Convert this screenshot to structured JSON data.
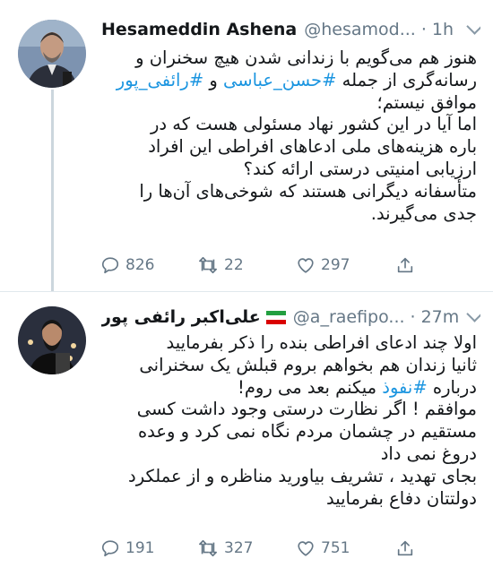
{
  "tweets": [
    {
      "name": "Hesameddin Ashena",
      "handle": "@hesamod...",
      "separator": "·",
      "time": "1h",
      "lines": [
        [
          {
            "t": "هنوز هم می‌گویم با زندانی شدن هیچ سخنران و",
            "tag": false
          }
        ],
        [
          {
            "t": "رسانه‌گری از جمله  ",
            "tag": false
          },
          {
            "t": "#حسن_عباسی",
            "tag": true
          },
          {
            "t": " و ",
            "tag": false
          },
          {
            "t": "#رائفی_پور",
            "tag": true
          }
        ],
        [
          {
            "t": "موافق نیستم؛",
            "tag": false
          }
        ],
        [
          {
            "t": "اما آیا در این کشور نهاد مسئولی هست که در",
            "tag": false
          }
        ],
        [
          {
            "t": "باره هزینه‌های ملی ادعاهای افراطی این افراد",
            "tag": false
          }
        ],
        [
          {
            "t": "ارزیابی امنیتی درستی ارائه کند؟",
            "tag": false
          }
        ],
        [
          {
            "t": "متأسفانه دیگرانی هستند که شوخی‌های آن‌ها را",
            "tag": false
          }
        ],
        [
          {
            "t": "جدی می‌گیرند.",
            "tag": false
          }
        ]
      ],
      "replies": "826",
      "retweets": "22",
      "likes": "297"
    },
    {
      "name": "علی‌اکبر رائفی پور",
      "handle": "@a_raefipo...",
      "separator": "·",
      "time": "27m",
      "lines": [
        [
          {
            "t": "اولا چند ادعای افراطی بنده را ذکر بفرمایید",
            "tag": false
          }
        ],
        [
          {
            "t": "ثانیا زندان هم بخواهم بروم قبلش یک سخنرانی",
            "tag": false
          }
        ],
        [
          {
            "t": "درباره ",
            "tag": false
          },
          {
            "t": "#نفوذ",
            "tag": true
          },
          {
            "t": " میکنم بعد می روم!",
            "tag": false
          }
        ],
        [
          {
            "t": "موافقم ! اگر نظارت درستی وجود داشت کسی",
            "tag": false
          }
        ],
        [
          {
            "t": "مستقیم در چشمان مردم نگاه نمی کرد و وعده",
            "tag": false
          }
        ],
        [
          {
            "t": "دروغ نمی داد",
            "tag": false
          }
        ],
        [
          {
            "t": "بجای تهدید ، تشریف بیاورید مناظره و از عملکرد",
            "tag": false
          }
        ],
        [
          {
            "t": "دولتتان دفاع بفرمایید",
            "tag": false
          }
        ]
      ],
      "replies": "191",
      "retweets": "327",
      "likes": "751"
    }
  ],
  "colors": {
    "hashtag": "#1b95e0",
    "muted": "#657786",
    "divider": "#e1e8ed",
    "thread": "#ccd6dd"
  },
  "icons": [
    "reply-icon",
    "retweet-icon",
    "like-icon",
    "share-icon",
    "chevron-down-icon",
    "iran-flag-icon"
  ]
}
